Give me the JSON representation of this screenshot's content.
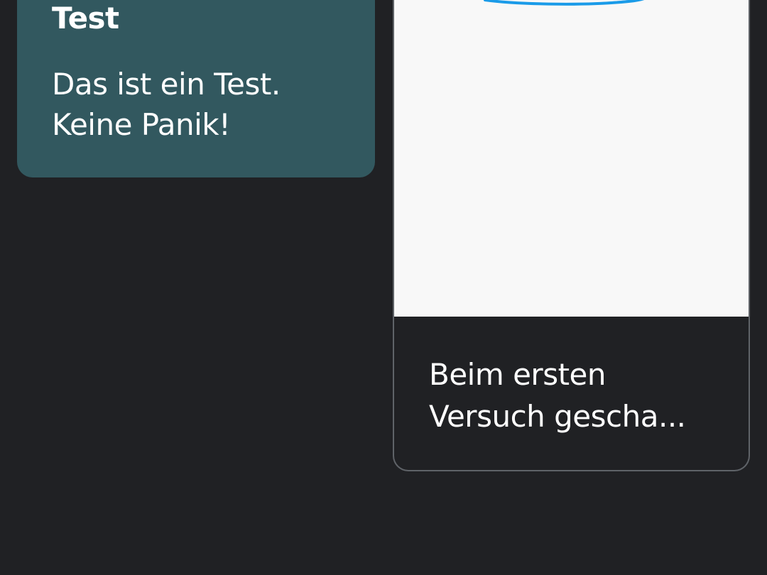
{
  "notes": [
    {
      "title": "Test",
      "body": "Das ist ein Test.\nKeine Panik!",
      "color": "#32585f"
    },
    {
      "body_lines": [
        "Beim ersten",
        "Versuch gescha..."
      ],
      "drawing_stroke_color": "#1a9be8",
      "border_color": "#5f6368"
    }
  ],
  "theme": {
    "background": "#202124",
    "drawing_background": "#f8f8f8"
  }
}
